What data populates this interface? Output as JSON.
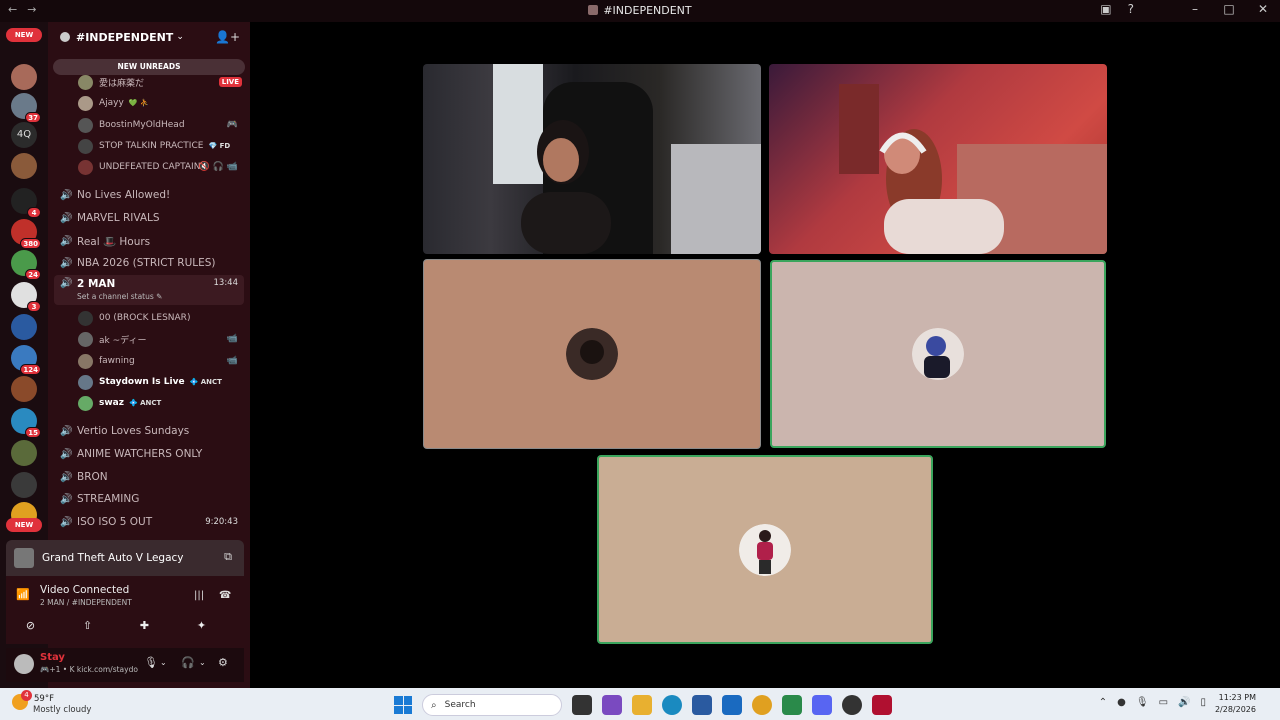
{
  "window": {
    "title": "#INDEPENDENT"
  },
  "rail": {
    "new_top": "NEW",
    "new_bottom": "NEW",
    "servers": [
      {
        "label": "",
        "badge": "",
        "color": "#a86a5a"
      },
      {
        "label": "",
        "badge": "37",
        "color": "#6a7a8a"
      },
      {
        "label": "4Q",
        "badge": "",
        "color": "#2b2b2b"
      },
      {
        "label": "",
        "badge": "",
        "color": "#8a5a3a"
      },
      {
        "label": "",
        "badge": "4",
        "color": "#222222"
      },
      {
        "label": "",
        "badge": "380",
        "color": "#c0302a"
      },
      {
        "label": "",
        "badge": "24",
        "color": "#4a9a4a"
      },
      {
        "label": "",
        "badge": "3",
        "color": "#e0e0e0"
      },
      {
        "label": "",
        "badge": "",
        "color": "#2a5aa0"
      },
      {
        "label": "",
        "badge": "124",
        "color": "#3a7ac0"
      },
      {
        "label": "",
        "badge": "",
        "color": "#8a4a2a"
      },
      {
        "label": "",
        "badge": "15",
        "color": "#2a8ac0"
      },
      {
        "label": "",
        "badge": "",
        "color": "#5a6a3a"
      },
      {
        "label": "",
        "badge": "",
        "color": "#3a3a3a"
      },
      {
        "label": "",
        "badge": "",
        "color": "#e0a020"
      }
    ]
  },
  "sidebar": {
    "server_name": "#INDEPENDENT",
    "new_unreads": "NEW UNREADS",
    "top_users": [
      {
        "name": "愛は麻薬だ",
        "tag": "",
        "live": "LIVE",
        "icons": "",
        "color": "#886"
      },
      {
        "name": "Ajayy",
        "tag": "💚 ⛹",
        "live": "",
        "icons": "",
        "color": "#a98"
      },
      {
        "name": "BoostinMyOldHead",
        "tag": "",
        "live": "",
        "icons": "🎮",
        "color": "#555"
      },
      {
        "name": "STOP TALKIN PRACTICE",
        "tag": "💎 FD",
        "live": "",
        "icons": "",
        "color": "#444"
      },
      {
        "name": "UNDEFEATED CAPTAIN",
        "tag": "",
        "live": "",
        "icons": "🔇 🎧 📹",
        "color": "#733"
      }
    ],
    "channels_a": [
      "No Lives Allowed!",
      "MARVEL RIVALS",
      "Real 🎩 Hours",
      "NBA 2026 (STRICT RULES)"
    ],
    "active_channel": {
      "name": "2 MAN",
      "time": "13:44",
      "status": "Set a channel status ✎"
    },
    "active_users": [
      {
        "name": "00 (BROCK LESNAR)",
        "tag": "",
        "icons": "",
        "bold": false,
        "color": "#333"
      },
      {
        "name": "ak ~ディー",
        "tag": "",
        "icons": "📹",
        "bold": false,
        "color": "#666"
      },
      {
        "name": "fawning",
        "tag": "",
        "icons": "📹",
        "bold": false,
        "color": "#876"
      },
      {
        "name": "Staydown Is Live",
        "tag": "💠 ANCT",
        "icons": "",
        "bold": true,
        "color": "#678"
      },
      {
        "name": "swaz",
        "tag": "💠 ANCT",
        "icons": "",
        "bold": true,
        "color": "#6a6"
      }
    ],
    "channels_b": [
      "Vertio Loves Sundays",
      "ANIME WATCHERS ONLY",
      "BRON",
      "STREAMING"
    ],
    "last_channel": {
      "name": "ISO ISO 5 OUT",
      "time": "9:20:43"
    }
  },
  "activity": {
    "game": "Grand Theft Auto V Legacy"
  },
  "voice": {
    "status": "Video Connected",
    "location": "2 MAN / #INDEPENDENT"
  },
  "user": {
    "name": "Stay",
    "status": "🎮+1 • K kick.com/staydo"
  },
  "taskbar": {
    "weather_badge": "4",
    "temp": "59°F",
    "condition": "Mostly cloudy",
    "search_placeholder": "Search",
    "time": "11:23 PM",
    "date": "2/28/2026"
  }
}
